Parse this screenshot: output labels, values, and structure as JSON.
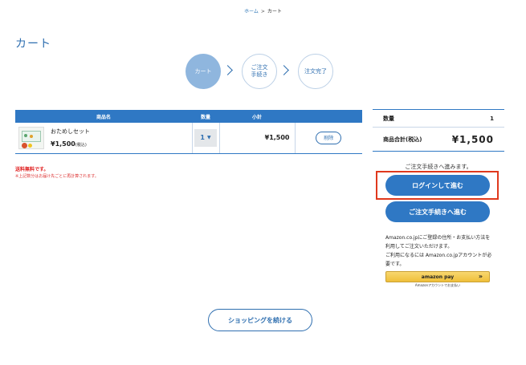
{
  "breadcrumb": {
    "home": "ホーム",
    "separator": ">",
    "current": "カート"
  },
  "page_title": "カート",
  "steps": [
    {
      "line1": "カート",
      "line2": "",
      "state": "active"
    },
    {
      "line1": "ご注文",
      "line2": "手続き",
      "state": "inactive"
    },
    {
      "line1": "注文完了",
      "line2": "",
      "state": "inactive"
    }
  ],
  "table": {
    "headers": [
      "商品名",
      "数量",
      "小計",
      ""
    ],
    "rows": [
      {
        "name": "おためしセット",
        "price": "¥1,500",
        "tax": "(税込)",
        "quantity": "1",
        "subtotal": "¥1,500",
        "delete": "削除"
      }
    ]
  },
  "notes": {
    "shipping": "送料無料です。",
    "split": "※上記数分はお届け先ごとに再計算されます。"
  },
  "summary": {
    "qty_label": "数量",
    "qty_value": "1",
    "total_label": "商品合計(税込)",
    "total_value": "¥1,500"
  },
  "actions": {
    "proceed_text": "ご注文手続きへ進みます。",
    "login": "ログインして進む",
    "checkout": "ご注文手続きへ進む",
    "continue": "ショッピングを続ける"
  },
  "amazon": {
    "text1": "Amazon.co.jpにご登録の住所・お支払い方法を利用してご注文いただけます。",
    "text2": "ご利用になるには Amazon.co.jpアカウントが必要です。",
    "button": "amazon pay",
    "sub": "Amazonアカウントでお支払い"
  },
  "colors": {
    "primary": "#2f78c4",
    "highlight": "#e0391d",
    "shipping_red": "#e02020"
  }
}
